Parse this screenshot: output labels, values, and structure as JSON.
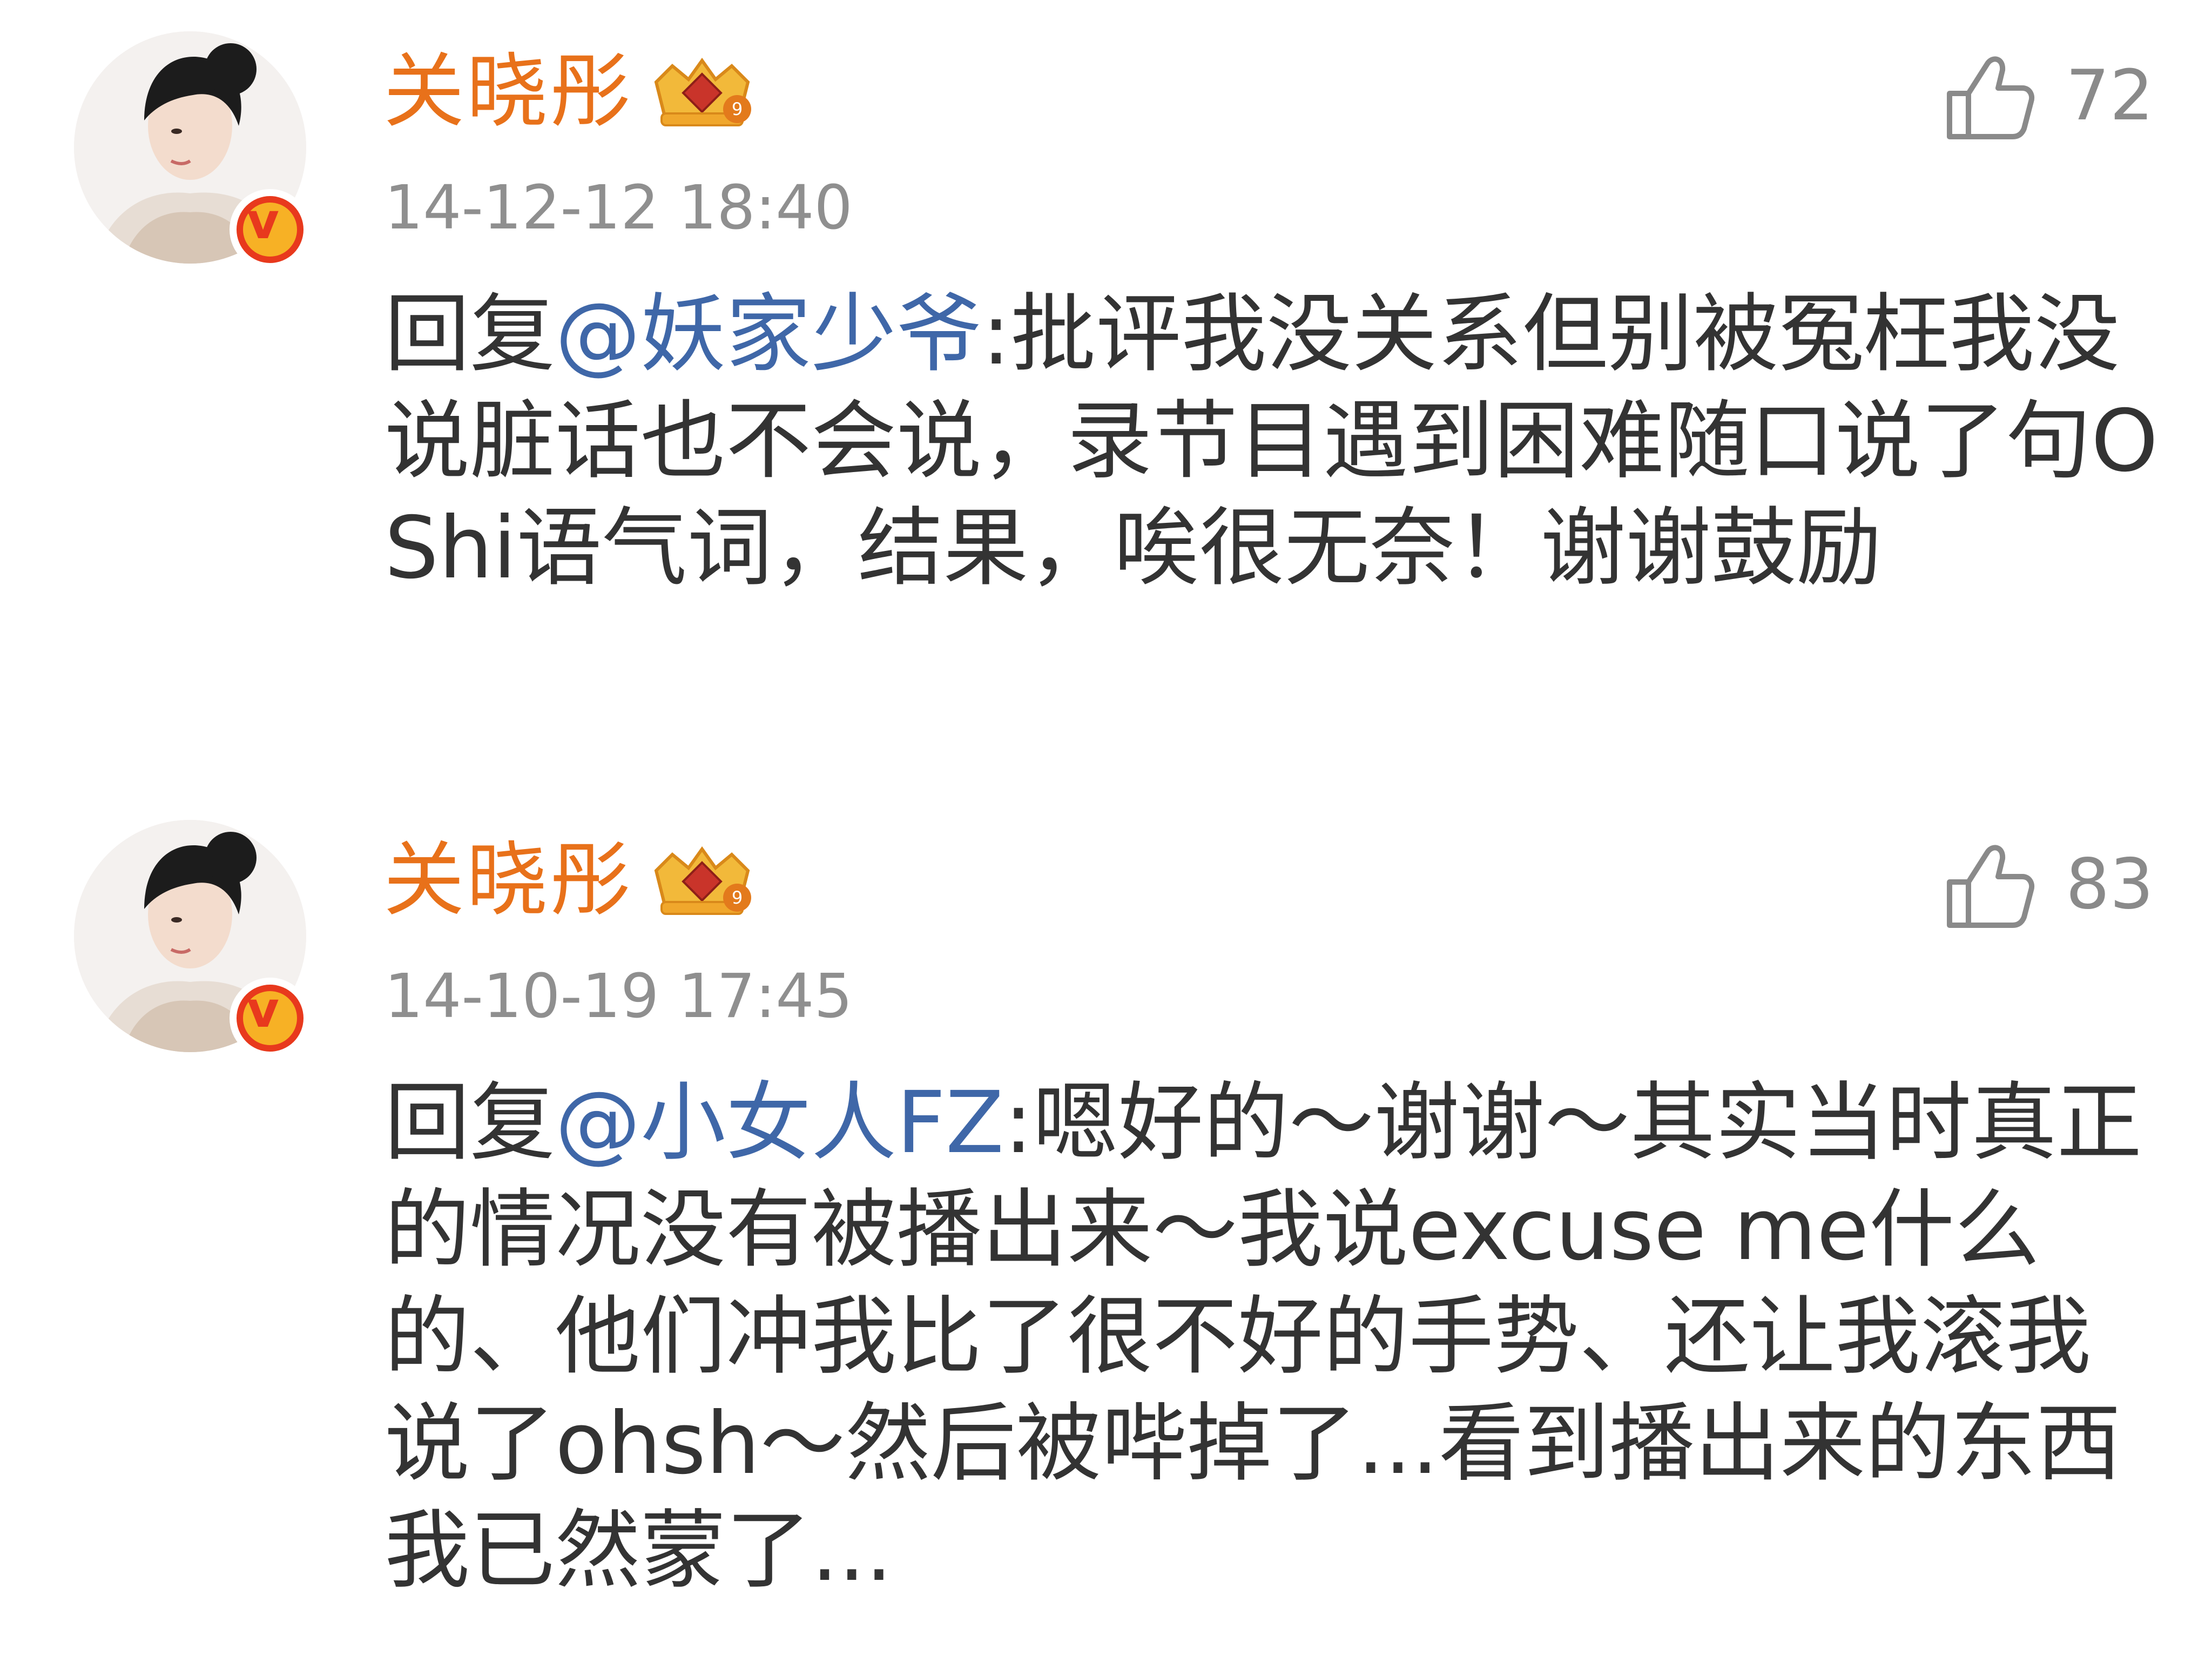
{
  "comments": [
    {
      "username": "关晓彤",
      "timestamp": "14-12-12 18:40",
      "likes": "72",
      "reply_prefix": "回复",
      "mention": "@妖家少爷",
      "text": ":批评我没关系但别被冤枉我没说脏话也不会说，录节目遇到困难随口说了句OShi语气词，结果，唉很无奈！谢谢鼓励",
      "level_badge": "9"
    },
    {
      "username": "关晓彤",
      "timestamp": "14-10-19 17:45",
      "likes": "83",
      "reply_prefix": "回复",
      "mention": "@小女人FZ",
      "text": ":嗯好的～谢谢～其实当时真正的情况没有被播出来～我说excuse me什么的、他们冲我比了很不好的手势、还让我滚我说了ohsh～然后被哔掉了...看到播出来的东西我已然蒙了...",
      "level_badge": "9"
    }
  ],
  "icons": {
    "like": "thumbs-up-icon",
    "verified": "verified-v-icon",
    "crown": "vip-crown-icon"
  },
  "colors": {
    "username": "#e8711a",
    "mention": "#3f67a8",
    "body": "#333333",
    "meta": "#8f8f8f",
    "verified_badge": "#e8391d"
  }
}
